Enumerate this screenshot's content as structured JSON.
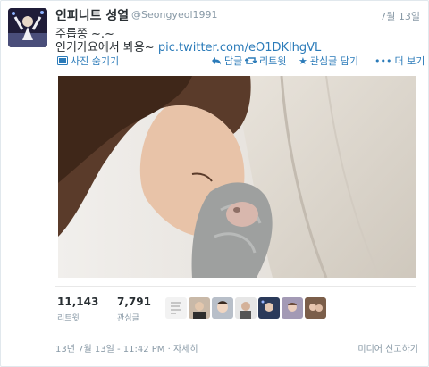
{
  "tweet": {
    "display_name": "인피니트 성열",
    "handle": "@Seongyeol1991",
    "date": "7월 13일",
    "text_line1": "주릅쫑 ~.~",
    "text_line2_prefix": "인기가요에서 봐용~",
    "link": "pic.twitter.com/eO1DKlhgVL"
  },
  "actions": {
    "hide_photo": "사진 숨기기",
    "reply": "답글",
    "retweet": "리트윗",
    "favorite": "관심글 담기",
    "more": "더 보기"
  },
  "stats": {
    "retweets_count": "11,143",
    "retweets_label": "리트윗",
    "favorites_count": "7,791",
    "favorites_label": "관심글"
  },
  "footer": {
    "timestamp": "13년 7월 13일 - 11:42 PM",
    "separator": "·",
    "details": "자세히",
    "report_media": "미디어 신고하기"
  },
  "colors": {
    "link": "#2b7bb9",
    "muted": "#8899a6",
    "text": "#292f33"
  },
  "icons": [
    "photo-icon",
    "reply-icon",
    "retweet-icon",
    "star-icon",
    "more-dots-icon"
  ]
}
